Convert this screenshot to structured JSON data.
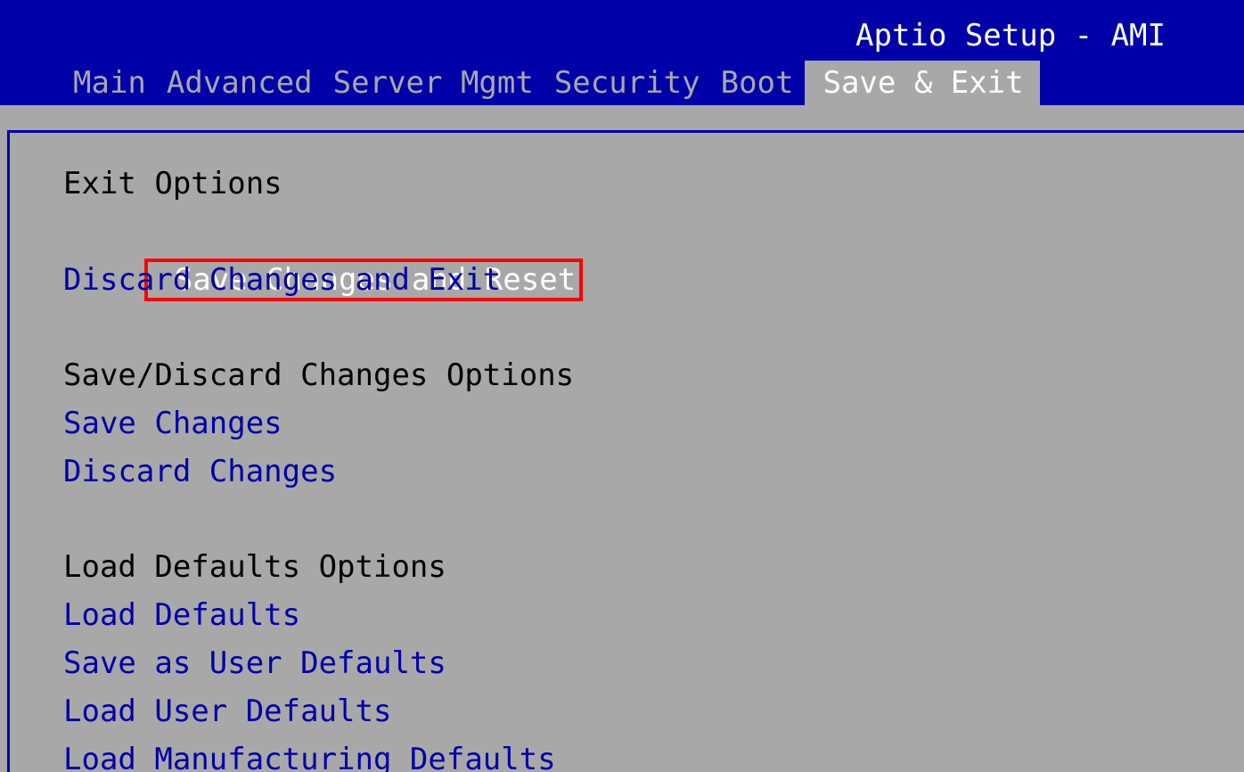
{
  "app_title": "Aptio Setup - AMI",
  "tabs": [
    {
      "label": "Main",
      "active": false
    },
    {
      "label": "Advanced",
      "active": false
    },
    {
      "label": "Server Mgmt",
      "active": false
    },
    {
      "label": "Security",
      "active": false
    },
    {
      "label": "Boot",
      "active": false
    },
    {
      "label": "Save & Exit",
      "active": true
    }
  ],
  "sections": [
    {
      "title": "Exit Options",
      "items": [
        {
          "label": "Save Changes and Reset",
          "selected": true
        },
        {
          "label": "Discard Changes and Exit",
          "selected": false
        }
      ]
    },
    {
      "title": "Save/Discard Changes Options",
      "items": [
        {
          "label": "Save Changes",
          "selected": false
        },
        {
          "label": "Discard Changes",
          "selected": false
        }
      ]
    },
    {
      "title": "Load Defaults Options",
      "items": [
        {
          "label": "Load Defaults",
          "selected": false
        },
        {
          "label": "Save as User Defaults",
          "selected": false
        },
        {
          "label": "Load User Defaults",
          "selected": false
        },
        {
          "label": "Load Manufacturing Defaults",
          "selected": false
        }
      ]
    }
  ],
  "colors": {
    "header_bg": "#0000a8",
    "panel_bg": "#a8a8a8",
    "item_text": "#0000a8",
    "section_text": "#000000",
    "selected_text": "#ffffff",
    "highlight_border": "#ff0000"
  }
}
